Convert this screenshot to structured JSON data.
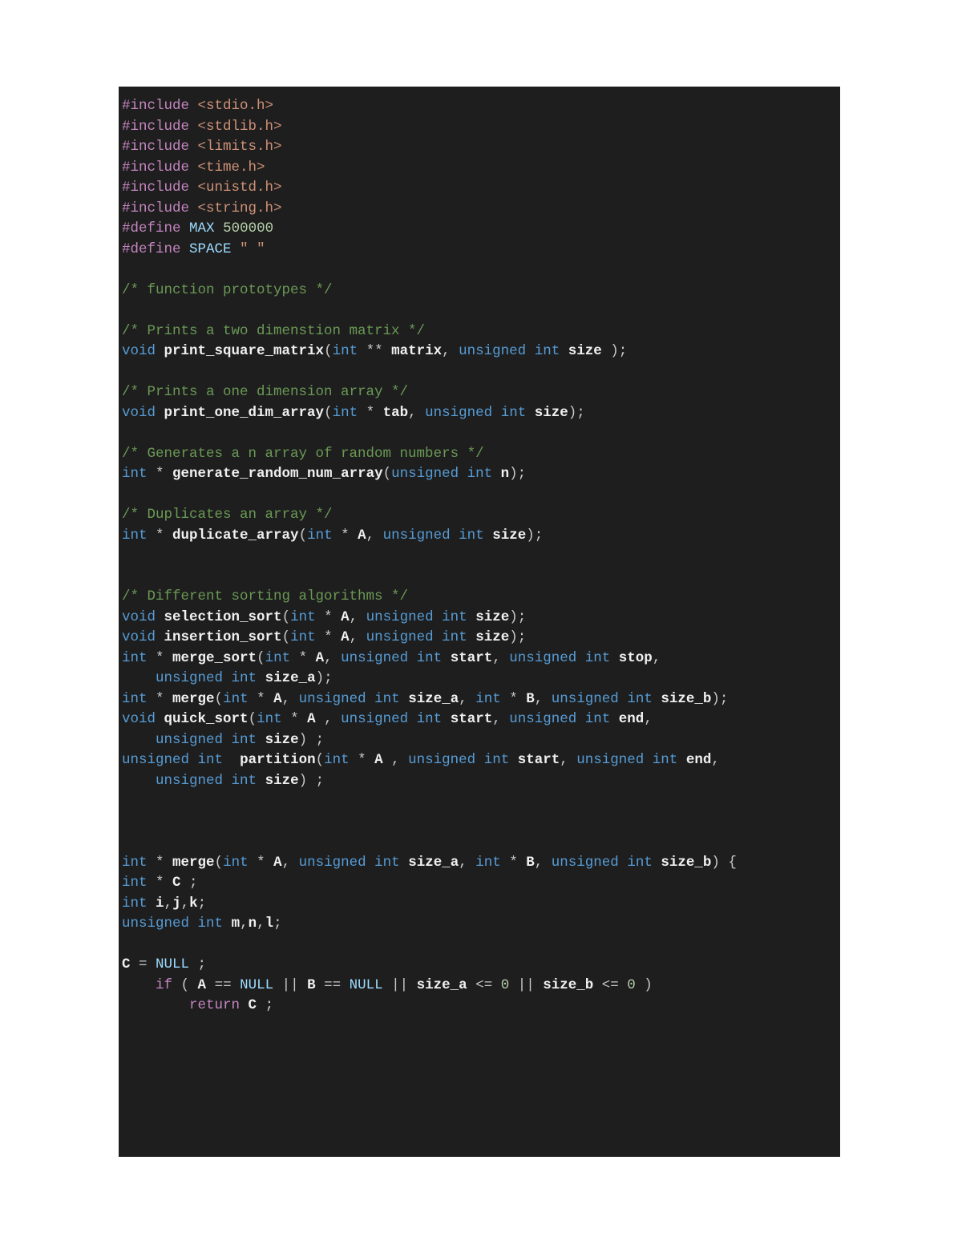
{
  "colors": {
    "bg": "#1e1e1e",
    "preprocessor": "#c586c0",
    "string": "#ce9178",
    "comment": "#6a9955",
    "type": "#569cd6",
    "constant": "#9cdcfe",
    "number": "#b5cea8",
    "control": "#c586c0",
    "default": "#e8e8e8"
  },
  "code_lines": [
    [
      [
        "kw-pre",
        "#include"
      ],
      [
        "ident",
        " "
      ],
      [
        "str",
        "<stdio.h>"
      ]
    ],
    [
      [
        "kw-pre",
        "#include"
      ],
      [
        "ident",
        " "
      ],
      [
        "str",
        "<stdlib.h>"
      ]
    ],
    [
      [
        "kw-pre",
        "#include"
      ],
      [
        "ident",
        " "
      ],
      [
        "str",
        "<limits.h>"
      ]
    ],
    [
      [
        "kw-pre",
        "#include"
      ],
      [
        "ident",
        " "
      ],
      [
        "str",
        "<time.h>"
      ]
    ],
    [
      [
        "kw-pre",
        "#include"
      ],
      [
        "ident",
        " "
      ],
      [
        "str",
        "<unistd.h>"
      ]
    ],
    [
      [
        "kw-pre",
        "#include"
      ],
      [
        "ident",
        " "
      ],
      [
        "str",
        "<string.h>"
      ]
    ],
    [
      [
        "kw-pre",
        "#define"
      ],
      [
        "ident",
        " "
      ],
      [
        "const",
        "MAX"
      ],
      [
        "ident",
        " "
      ],
      [
        "num",
        "500000"
      ]
    ],
    [
      [
        "kw-pre",
        "#define"
      ],
      [
        "ident",
        " "
      ],
      [
        "const",
        "SPACE"
      ],
      [
        "ident",
        " "
      ],
      [
        "str",
        "\" \""
      ]
    ],
    [
      [
        "ident",
        ""
      ]
    ],
    [
      [
        "com",
        "/* function prototypes */"
      ]
    ],
    [
      [
        "ident",
        ""
      ]
    ],
    [
      [
        "com",
        "/* Prints a two dimenstion matrix */"
      ]
    ],
    [
      [
        "type",
        "void"
      ],
      [
        "ident",
        " "
      ],
      [
        "white",
        "print_square_matrix"
      ],
      [
        "ident",
        "("
      ],
      [
        "type",
        "int"
      ],
      [
        "ident",
        " ** "
      ],
      [
        "white",
        "matrix"
      ],
      [
        "ident",
        ", "
      ],
      [
        "type",
        "unsigned"
      ],
      [
        "ident",
        " "
      ],
      [
        "type",
        "int"
      ],
      [
        "ident",
        " "
      ],
      [
        "white",
        "size"
      ],
      [
        "ident",
        " );"
      ]
    ],
    [
      [
        "ident",
        ""
      ]
    ],
    [
      [
        "com",
        "/* Prints a one dimension array */"
      ]
    ],
    [
      [
        "type",
        "void"
      ],
      [
        "ident",
        " "
      ],
      [
        "white",
        "print_one_dim_array"
      ],
      [
        "ident",
        "("
      ],
      [
        "type",
        "int"
      ],
      [
        "ident",
        " * "
      ],
      [
        "white",
        "tab"
      ],
      [
        "ident",
        ", "
      ],
      [
        "type",
        "unsigned"
      ],
      [
        "ident",
        " "
      ],
      [
        "type",
        "int"
      ],
      [
        "ident",
        " "
      ],
      [
        "white",
        "size"
      ],
      [
        "ident",
        ");"
      ]
    ],
    [
      [
        "ident",
        ""
      ]
    ],
    [
      [
        "com",
        "/* Generates a n array of random numbers */"
      ]
    ],
    [
      [
        "type",
        "int"
      ],
      [
        "ident",
        " * "
      ],
      [
        "white",
        "generate_random_num_array"
      ],
      [
        "ident",
        "("
      ],
      [
        "type",
        "unsigned"
      ],
      [
        "ident",
        " "
      ],
      [
        "type",
        "int"
      ],
      [
        "ident",
        " "
      ],
      [
        "white",
        "n"
      ],
      [
        "ident",
        ");"
      ]
    ],
    [
      [
        "ident",
        ""
      ]
    ],
    [
      [
        "com",
        "/* Duplicates an array */"
      ]
    ],
    [
      [
        "type",
        "int"
      ],
      [
        "ident",
        " * "
      ],
      [
        "white",
        "duplicate_array"
      ],
      [
        "ident",
        "("
      ],
      [
        "type",
        "int"
      ],
      [
        "ident",
        " * "
      ],
      [
        "white",
        "A"
      ],
      [
        "ident",
        ", "
      ],
      [
        "type",
        "unsigned"
      ],
      [
        "ident",
        " "
      ],
      [
        "type",
        "int"
      ],
      [
        "ident",
        " "
      ],
      [
        "white",
        "size"
      ],
      [
        "ident",
        ");"
      ]
    ],
    [
      [
        "ident",
        ""
      ]
    ],
    [
      [
        "ident",
        ""
      ]
    ],
    [
      [
        "com",
        "/* Different sorting algorithms */"
      ]
    ],
    [
      [
        "type",
        "void"
      ],
      [
        "ident",
        " "
      ],
      [
        "white",
        "selection_sort"
      ],
      [
        "ident",
        "("
      ],
      [
        "type",
        "int"
      ],
      [
        "ident",
        " * "
      ],
      [
        "white",
        "A"
      ],
      [
        "ident",
        ", "
      ],
      [
        "type",
        "unsigned"
      ],
      [
        "ident",
        " "
      ],
      [
        "type",
        "int"
      ],
      [
        "ident",
        " "
      ],
      [
        "white",
        "size"
      ],
      [
        "ident",
        ");"
      ]
    ],
    [
      [
        "type",
        "void"
      ],
      [
        "ident",
        " "
      ],
      [
        "white",
        "insertion_sort"
      ],
      [
        "ident",
        "("
      ],
      [
        "type",
        "int"
      ],
      [
        "ident",
        " * "
      ],
      [
        "white",
        "A"
      ],
      [
        "ident",
        ", "
      ],
      [
        "type",
        "unsigned"
      ],
      [
        "ident",
        " "
      ],
      [
        "type",
        "int"
      ],
      [
        "ident",
        " "
      ],
      [
        "white",
        "size"
      ],
      [
        "ident",
        ");"
      ]
    ],
    [
      [
        "type",
        "int"
      ],
      [
        "ident",
        " * "
      ],
      [
        "white",
        "merge_sort"
      ],
      [
        "ident",
        "("
      ],
      [
        "type",
        "int"
      ],
      [
        "ident",
        " * "
      ],
      [
        "white",
        "A"
      ],
      [
        "ident",
        ", "
      ],
      [
        "type",
        "unsigned"
      ],
      [
        "ident",
        " "
      ],
      [
        "type",
        "int"
      ],
      [
        "ident",
        " "
      ],
      [
        "white",
        "start"
      ],
      [
        "ident",
        ", "
      ],
      [
        "type",
        "unsigned"
      ],
      [
        "ident",
        " "
      ],
      [
        "type",
        "int"
      ],
      [
        "ident",
        " "
      ],
      [
        "white",
        "stop"
      ],
      [
        "ident",
        ","
      ]
    ],
    [
      [
        "ident",
        "    "
      ],
      [
        "type",
        "unsigned"
      ],
      [
        "ident",
        " "
      ],
      [
        "type",
        "int"
      ],
      [
        "ident",
        " "
      ],
      [
        "white",
        "size_a"
      ],
      [
        "ident",
        ");"
      ]
    ],
    [
      [
        "type",
        "int"
      ],
      [
        "ident",
        " * "
      ],
      [
        "white",
        "merge"
      ],
      [
        "ident",
        "("
      ],
      [
        "type",
        "int"
      ],
      [
        "ident",
        " * "
      ],
      [
        "white",
        "A"
      ],
      [
        "ident",
        ", "
      ],
      [
        "type",
        "unsigned"
      ],
      [
        "ident",
        " "
      ],
      [
        "type",
        "int"
      ],
      [
        "ident",
        " "
      ],
      [
        "white",
        "size_a"
      ],
      [
        "ident",
        ", "
      ],
      [
        "type",
        "int"
      ],
      [
        "ident",
        " * "
      ],
      [
        "white",
        "B"
      ],
      [
        "ident",
        ", "
      ],
      [
        "type",
        "unsigned"
      ],
      [
        "ident",
        " "
      ],
      [
        "type",
        "int"
      ],
      [
        "ident",
        " "
      ],
      [
        "white",
        "size_b"
      ],
      [
        "ident",
        ");"
      ]
    ],
    [
      [
        "type",
        "void"
      ],
      [
        "ident",
        " "
      ],
      [
        "white",
        "quick_sort"
      ],
      [
        "ident",
        "("
      ],
      [
        "type",
        "int"
      ],
      [
        "ident",
        " * "
      ],
      [
        "white",
        "A"
      ],
      [
        "ident",
        " , "
      ],
      [
        "type",
        "unsigned"
      ],
      [
        "ident",
        " "
      ],
      [
        "type",
        "int"
      ],
      [
        "ident",
        " "
      ],
      [
        "white",
        "start"
      ],
      [
        "ident",
        ", "
      ],
      [
        "type",
        "unsigned"
      ],
      [
        "ident",
        " "
      ],
      [
        "type",
        "int"
      ],
      [
        "ident",
        " "
      ],
      [
        "white",
        "end"
      ],
      [
        "ident",
        ","
      ]
    ],
    [
      [
        "ident",
        "    "
      ],
      [
        "type",
        "unsigned"
      ],
      [
        "ident",
        " "
      ],
      [
        "type",
        "int"
      ],
      [
        "ident",
        " "
      ],
      [
        "white",
        "size"
      ],
      [
        "ident",
        ") ;"
      ]
    ],
    [
      [
        "type",
        "unsigned"
      ],
      [
        "ident",
        " "
      ],
      [
        "type",
        "int"
      ],
      [
        "ident",
        "  "
      ],
      [
        "white",
        "partition"
      ],
      [
        "ident",
        "("
      ],
      [
        "type",
        "int"
      ],
      [
        "ident",
        " * "
      ],
      [
        "white",
        "A"
      ],
      [
        "ident",
        " , "
      ],
      [
        "type",
        "unsigned"
      ],
      [
        "ident",
        " "
      ],
      [
        "type",
        "int"
      ],
      [
        "ident",
        " "
      ],
      [
        "white",
        "start"
      ],
      [
        "ident",
        ", "
      ],
      [
        "type",
        "unsigned"
      ],
      [
        "ident",
        " "
      ],
      [
        "type",
        "int"
      ],
      [
        "ident",
        " "
      ],
      [
        "white",
        "end"
      ],
      [
        "ident",
        ","
      ]
    ],
    [
      [
        "ident",
        "    "
      ],
      [
        "type",
        "unsigned"
      ],
      [
        "ident",
        " "
      ],
      [
        "type",
        "int"
      ],
      [
        "ident",
        " "
      ],
      [
        "white",
        "size"
      ],
      [
        "ident",
        ") ;"
      ]
    ],
    [
      [
        "ident",
        ""
      ]
    ],
    [
      [
        "ident",
        ""
      ]
    ],
    [
      [
        "ident",
        ""
      ]
    ],
    [
      [
        "type",
        "int"
      ],
      [
        "ident",
        " * "
      ],
      [
        "white",
        "merge"
      ],
      [
        "ident",
        "("
      ],
      [
        "type",
        "int"
      ],
      [
        "ident",
        " * "
      ],
      [
        "white",
        "A"
      ],
      [
        "ident",
        ", "
      ],
      [
        "type",
        "unsigned"
      ],
      [
        "ident",
        " "
      ],
      [
        "type",
        "int"
      ],
      [
        "ident",
        " "
      ],
      [
        "white",
        "size_a"
      ],
      [
        "ident",
        ", "
      ],
      [
        "type",
        "int"
      ],
      [
        "ident",
        " * "
      ],
      [
        "white",
        "B"
      ],
      [
        "ident",
        ", "
      ],
      [
        "type",
        "unsigned"
      ],
      [
        "ident",
        " "
      ],
      [
        "type",
        "int"
      ],
      [
        "ident",
        " "
      ],
      [
        "white",
        "size_b"
      ],
      [
        "ident",
        ") {"
      ]
    ],
    [
      [
        "type",
        "int"
      ],
      [
        "ident",
        " * "
      ],
      [
        "white",
        "C"
      ],
      [
        "ident",
        " ;"
      ]
    ],
    [
      [
        "type",
        "int"
      ],
      [
        "ident",
        " "
      ],
      [
        "white",
        "i"
      ],
      [
        "ident",
        ","
      ],
      [
        "white",
        "j"
      ],
      [
        "ident",
        ","
      ],
      [
        "white",
        "k"
      ],
      [
        "ident",
        ";"
      ]
    ],
    [
      [
        "type",
        "unsigned"
      ],
      [
        "ident",
        " "
      ],
      [
        "type",
        "int"
      ],
      [
        "ident",
        " "
      ],
      [
        "white",
        "m"
      ],
      [
        "ident",
        ","
      ],
      [
        "white",
        "n"
      ],
      [
        "ident",
        ","
      ],
      [
        "white",
        "l"
      ],
      [
        "ident",
        ";"
      ]
    ],
    [
      [
        "ident",
        ""
      ]
    ],
    [
      [
        "white",
        "C"
      ],
      [
        "ident",
        " = "
      ],
      [
        "const",
        "NULL"
      ],
      [
        "ident",
        " ;"
      ]
    ],
    [
      [
        "ident",
        "    "
      ],
      [
        "kw-ctrl",
        "if"
      ],
      [
        "ident",
        " ( "
      ],
      [
        "white",
        "A"
      ],
      [
        "ident",
        " == "
      ],
      [
        "const",
        "NULL"
      ],
      [
        "ident",
        " || "
      ],
      [
        "white",
        "B"
      ],
      [
        "ident",
        " == "
      ],
      [
        "const",
        "NULL"
      ],
      [
        "ident",
        " || "
      ],
      [
        "white",
        "size_a"
      ],
      [
        "ident",
        " <= "
      ],
      [
        "num",
        "0"
      ],
      [
        "ident",
        " || "
      ],
      [
        "white",
        "size_b"
      ],
      [
        "ident",
        " <= "
      ],
      [
        "num",
        "0"
      ],
      [
        "ident",
        " )"
      ]
    ],
    [
      [
        "ident",
        "        "
      ],
      [
        "kw-ctrl",
        "return"
      ],
      [
        "ident",
        " "
      ],
      [
        "white",
        "C"
      ],
      [
        "ident",
        " ;"
      ]
    ]
  ]
}
